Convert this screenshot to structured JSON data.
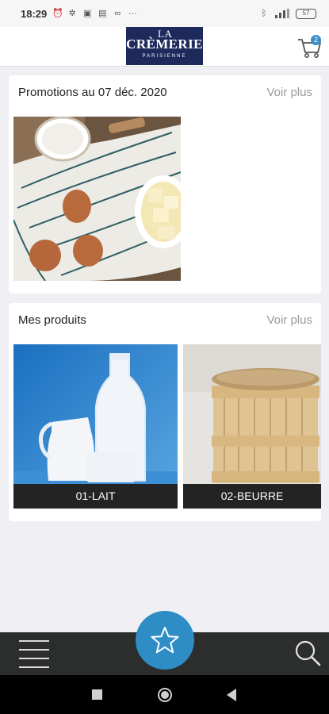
{
  "status_bar": {
    "time": "18:29",
    "battery": "57",
    "icons": [
      "alarm-icon",
      "app-icon",
      "linkedin-icon",
      "calendar-icon",
      "voicemail-icon",
      "more-dots-icon",
      "bluetooth-icon",
      "signal-icon",
      "battery-icon"
    ]
  },
  "header": {
    "logo": {
      "top": "LA",
      "main": "CRÈMERIE",
      "sub": "PARISIENNE"
    },
    "cart_count": "2"
  },
  "promotions": {
    "title": "Promotions au 07 déc. 2020",
    "more_label": "Voir plus"
  },
  "products": {
    "title": "Mes produits",
    "more_label": "Voir plus",
    "items": [
      {
        "label": "01-LAIT"
      },
      {
        "label": "02-BEURRE"
      }
    ]
  },
  "bottom_nav": {
    "menu": "menu-icon",
    "favorite": "star-icon",
    "search": "search-icon"
  },
  "colors": {
    "brand_navy": "#1f2a5c",
    "accent_blue": "#2f8dc6",
    "nav_dark": "#2c2e2e"
  }
}
